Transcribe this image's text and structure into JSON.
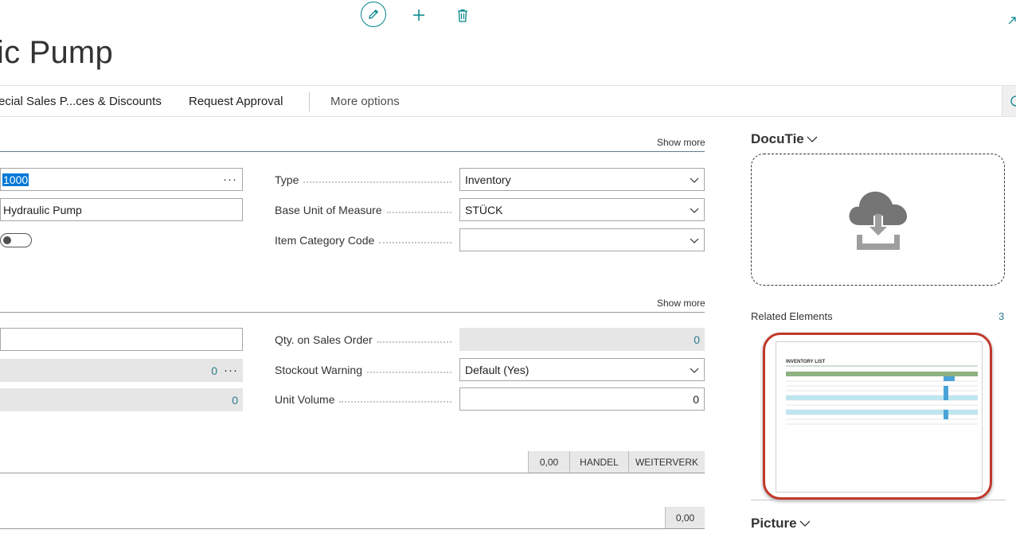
{
  "toolbar": {
    "edit_icon": "pencil-icon",
    "new_icon": "plus-icon",
    "delete_icon": "trash-icon",
    "expand_icon": "arrow-up-right-icon"
  },
  "page": {
    "title": "ic Pump"
  },
  "actions": {
    "items": [
      "ecial Sales P...ces & Discounts",
      "Request Approval"
    ],
    "more_options": "More options"
  },
  "general": {
    "show_more": "Show more",
    "no": "1000",
    "description": "Hydraulic Pump",
    "blocked": false,
    "type_label": "Type",
    "type_value": "Inventory",
    "base_uom_label": "Base Unit of Measure",
    "base_uom_value": "STÜCK",
    "item_category_label": "Item Category Code",
    "item_category_value": ""
  },
  "inventory": {
    "show_more": "Show more",
    "field1_value": "",
    "field2_value": "0",
    "field3_value": "0",
    "qty_sales_label": "Qty. on Sales Order",
    "qty_sales_value": "0",
    "stockout_label": "Stockout Warning",
    "stockout_value": "Default (Yes)",
    "unit_volume_label": "Unit Volume",
    "unit_volume_value": "0"
  },
  "chips": [
    "0,00",
    "HANDEL",
    "WEITERVERK"
  ],
  "bottom_chip": "0,00",
  "factbox": {
    "docutie_title": "DocuTie",
    "related_label": "Related Elements",
    "related_count": "3",
    "thumb_title": "INVENTORY LIST",
    "picture_title": "Picture"
  },
  "colors": {
    "accent": "#008489",
    "selection": "#0078d7",
    "frame": "#c0392b"
  }
}
